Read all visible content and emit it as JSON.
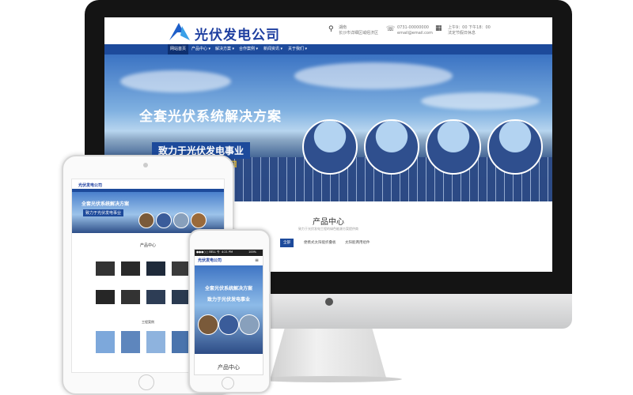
{
  "site": {
    "logo_text": "光伏发电公司",
    "address_line1": "湖南",
    "address_line2": "长沙市详细区域经济区",
    "phone_line1": "0731-00000000",
    "phone_line2": "email@email.com",
    "hours_line1": "上午9：00 下午18：00",
    "hours_line2": "法定节假日休息"
  },
  "nav": [
    {
      "label": "网站首页"
    },
    {
      "label": "产品中心 ▾"
    },
    {
      "label": "解决方案 ▾"
    },
    {
      "label": "合作案例 ▾"
    },
    {
      "label": "新闻资讯 ▾"
    },
    {
      "label": "关于我们 ▾"
    }
  ],
  "banner": {
    "title": "全套光伏系统解决方案",
    "subtitle": "致力于光伏发电事业",
    "tag": "项目"
  },
  "products": {
    "title": "产品中心",
    "desc": "致力于光伏发电工程的绿色能源方案提供商",
    "categories": [
      "全部",
      "便携式太阳能折叠板",
      "太阳能两用组件"
    ]
  },
  "tablet": {
    "logo_text": "光伏发电公司",
    "banner_title": "全套光伏系统解决方案",
    "banner_sub": "致力于光伏发电事业",
    "section_title": "产品中心",
    "section2_title": "工程案例"
  },
  "phone": {
    "status_left": "●●●○○ BELL 令",
    "status_time": "4:21 PM",
    "status_right": "100%",
    "logo_text": "光伏发电公司",
    "banner_title": "全套光伏系统解决方案",
    "banner_sub": "致力于光伏发电事业",
    "section_title": "产品中心"
  },
  "colors": {
    "brand": "#1d4a9b",
    "nav_active": "#0e2f70"
  }
}
